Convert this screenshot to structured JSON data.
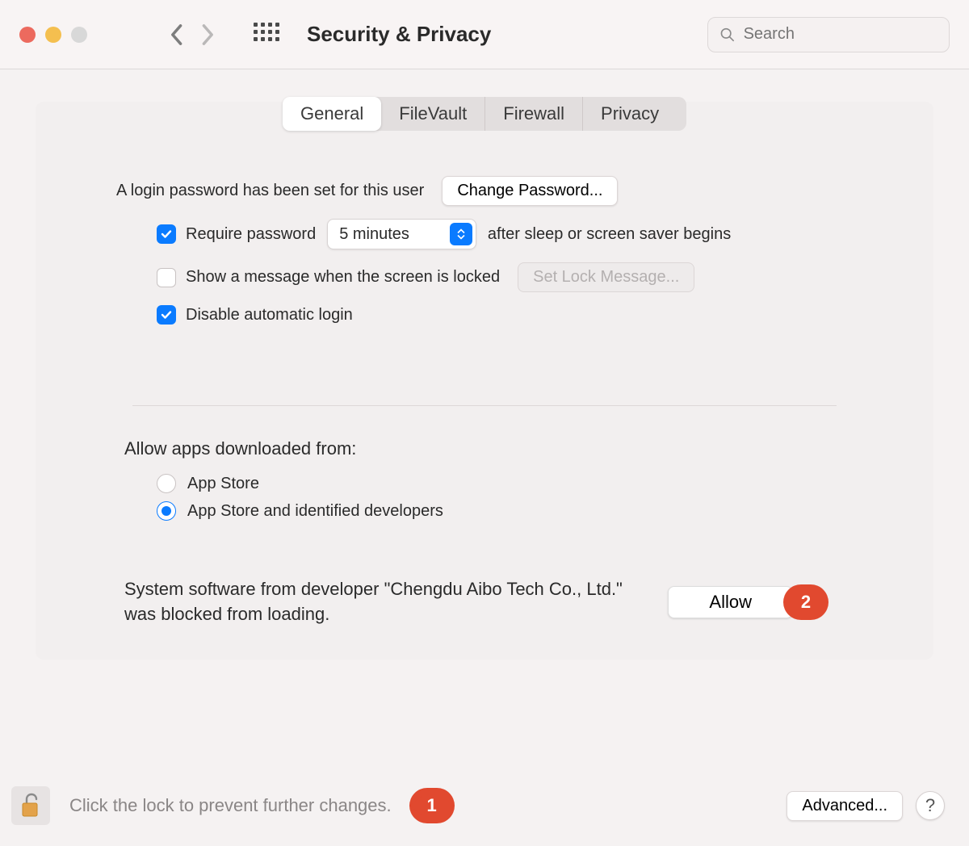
{
  "window": {
    "title": "Security & Privacy"
  },
  "toolbar": {
    "search_placeholder": "Search"
  },
  "tabs": {
    "general": "General",
    "filevault": "FileVault",
    "firewall": "Firewall",
    "privacy": "Privacy",
    "active": "general"
  },
  "general": {
    "login_pw_text": "A login password has been set for this user",
    "change_pw_label": "Change Password...",
    "require_pw_prefix": "Require password",
    "require_pw_suffix": "after sleep or screen saver begins",
    "require_pw_delay": "5 minutes",
    "require_pw_checked": true,
    "show_message_label": "Show a message when the screen is locked",
    "show_message_checked": false,
    "set_lock_msg_label": "Set Lock Message...",
    "disable_auto_login_label": "Disable automatic login",
    "disable_auto_login_checked": true,
    "allow_apps_heading": "Allow apps downloaded from:",
    "allow_apps_options": {
      "app_store": "App Store",
      "identified": "App Store and identified developers"
    },
    "allow_apps_selected": "identified",
    "blocked_text": "System software from developer \"Chengdu Aibo Tech Co., Ltd.\" was blocked from loading.",
    "allow_label": "Allow"
  },
  "footer": {
    "lock_text": "Click the lock to prevent further changes.",
    "advanced_label": "Advanced...",
    "help_label": "?"
  },
  "annotations": {
    "pin1": "1",
    "pin2": "2"
  }
}
